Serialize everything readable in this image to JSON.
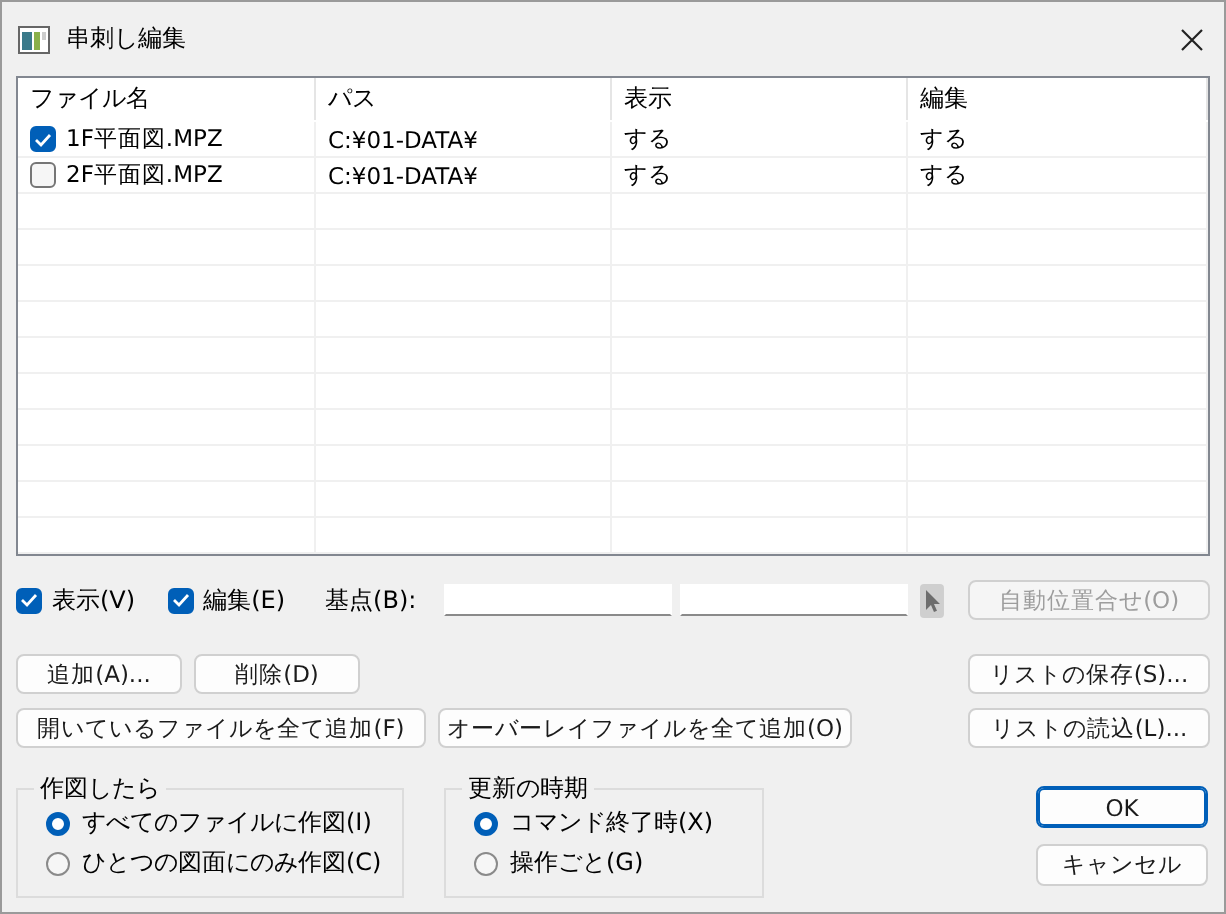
{
  "window": {
    "title": "串刺し編集"
  },
  "table": {
    "columns": [
      "ファイル名",
      "パス",
      "表示",
      "編集"
    ],
    "rows": [
      {
        "checked": true,
        "cells": [
          "1F平面図.MPZ",
          "C:¥01-DATA¥",
          "する",
          "する"
        ]
      },
      {
        "checked": false,
        "cells": [
          "2F平面図.MPZ",
          "C:¥01-DATA¥",
          "する",
          "する"
        ]
      }
    ]
  },
  "toggles": [
    {
      "label": "表示(V)",
      "checked": true
    },
    {
      "label": "編集(E)",
      "checked": true
    }
  ],
  "base_point": {
    "label": "基点(B):"
  },
  "auto_button": {
    "label": "自動位置合せ(O)",
    "disabled": true
  },
  "button_rows": [
    {
      "left": [
        "追加(A)...",
        "削除(D)"
      ],
      "right": "リストの保存(S)..."
    },
    {
      "left": [
        "開いているファイルを全て追加(F)",
        "オーバーレイファイルを全て追加(O)"
      ],
      "right": "リストの読込(L)..."
    }
  ],
  "groups": [
    {
      "title": "作図したら",
      "options": [
        {
          "label": "すべてのファイルに作図(I)",
          "selected": true
        },
        {
          "label": "ひとつの図面にのみ作図(C)",
          "selected": false
        }
      ]
    },
    {
      "title": "更新の時期",
      "options": [
        {
          "label": "コマンド終了時(X)",
          "selected": true
        },
        {
          "label": "操作ごと(G)",
          "selected": false
        }
      ]
    }
  ],
  "dialog_buttons": [
    {
      "label": "OK",
      "default": true
    },
    {
      "label": "キャンセル",
      "default": false
    }
  ]
}
